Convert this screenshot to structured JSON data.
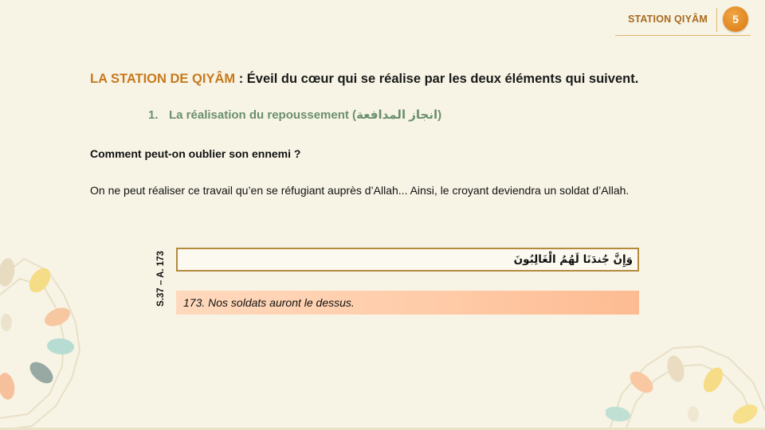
{
  "header": {
    "title": "STATION QIYÂM",
    "page_number": "5"
  },
  "heading": {
    "accent": "LA STATION DE QIYÂM",
    "rest": " : Éveil du cœur qui se réalise par les deux éléments qui suivent."
  },
  "point": {
    "number": "1.",
    "text": "La réalisation du repoussement (انجاز المدافعة)"
  },
  "question": "Comment peut-on oublier son ennemi ?",
  "paragraph": "On ne peut réaliser ce travail qu’en se réfugiant auprès d’Allah... Ainsi, le croyant deviendra un soldat d’Allah.",
  "verse": {
    "reference": "S.37 – A. 173",
    "arabic": "وَإِنَّ جُندَنَا لَهُمُ الْغَالِبُونَ",
    "translation": "173. Nos soldats auront le dessus."
  },
  "colors": {
    "accent": "#c7791c",
    "green_heading": "#6b8f6d",
    "badge": "#e08a1f",
    "box_border": "#b48a3c",
    "translation_bg": "#ffcaa6"
  }
}
